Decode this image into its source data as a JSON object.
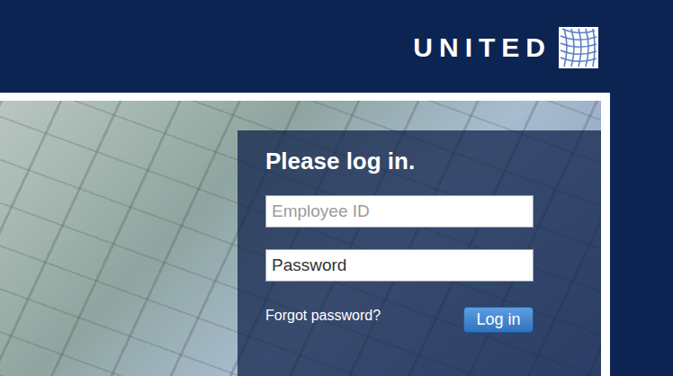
{
  "logo": {
    "text": "UNITED"
  },
  "login": {
    "title": "Please log in.",
    "fields": [
      {
        "placeholder": "Employee ID",
        "kind": "placeholder"
      },
      {
        "placeholder": "Password",
        "kind": "label"
      }
    ],
    "forgot_link": "Forgot password?",
    "button": "Log in"
  }
}
